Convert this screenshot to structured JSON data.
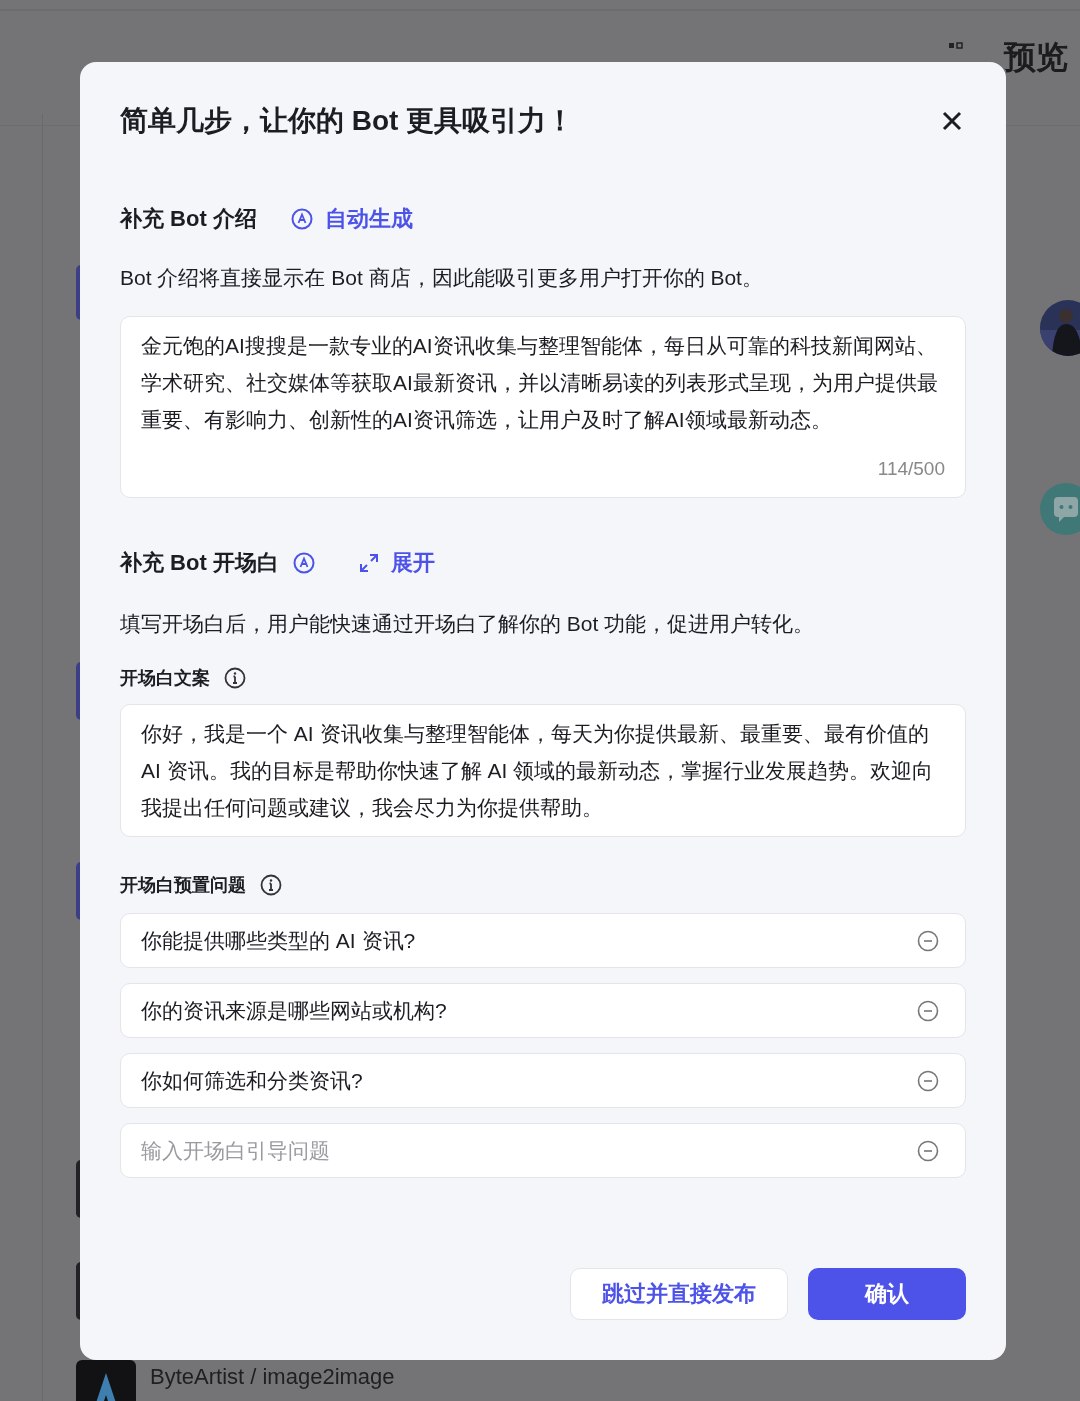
{
  "background": {
    "header_text": "预览",
    "bottom_item": {
      "title": "ByteArtist / image2image"
    }
  },
  "dialog": {
    "title": "简单几步，让你的 Bot 更具吸引力！",
    "intro": {
      "heading": "补充 Bot 介绍",
      "action": "自动生成",
      "description": "Bot 介绍将直接显示在 Bot 商店，因此能吸引更多用户打开你的 Bot。",
      "value": "金元饱的AI搜搜是一款专业的AI资讯收集与整理智能体，每日从可靠的科技新闻网站、学术研究、社交媒体等获取AI最新资讯，并以清晰易读的列表形式呈现，为用户提供最重要、有影响力、创新性的AI资讯筛选，让用户及时了解AI领域最新动态。",
      "counter": "114/500"
    },
    "opening": {
      "heading": "补充 Bot 开场白",
      "action": "展开",
      "description": "填写开场白后，用户能快速通过开场白了解你的 Bot 功能，促进用户转化。",
      "text_label": "开场白文案",
      "text_value": "你好，我是一个 AI 资讯收集与整理智能体，每天为你提供最新、最重要、最有价值的 AI 资讯。我的目标是帮助你快速了解 AI 领域的最新动态，掌握行业发展趋势。欢迎向我提出任何问题或建议，我会尽力为你提供帮助。",
      "questions_label": "开场白预置问题",
      "questions": [
        {
          "value": "你能提供哪些类型的 AI 资讯?"
        },
        {
          "value": "你的资讯来源是哪些网站或机构?"
        },
        {
          "value": "你如何筛选和分类资讯?"
        },
        {
          "placeholder": "输入开场白引导问题"
        }
      ]
    },
    "buttons": [
      {
        "label": "跳过并直接发布",
        "kind": "secondary"
      },
      {
        "label": "确认",
        "kind": "primary"
      }
    ]
  }
}
